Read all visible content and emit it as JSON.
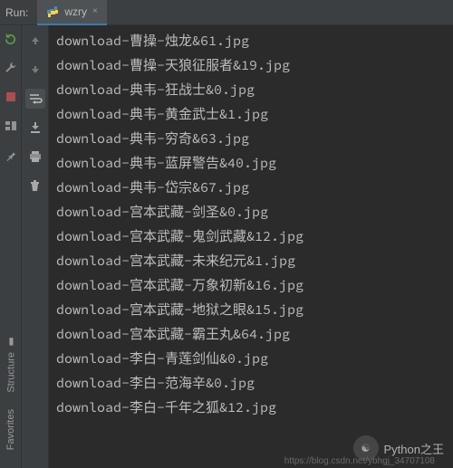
{
  "header": {
    "run_label": "Run:",
    "tab": {
      "label": "wzry",
      "close": "×"
    }
  },
  "console": {
    "lines": [
      "download-曹操-烛龙&61.jpg",
      "download-曹操-天狼征服者&19.jpg",
      "download-典韦-狂战士&0.jpg",
      "download-典韦-黄金武士&1.jpg",
      "download-典韦-穷奇&63.jpg",
      "download-典韦-蓝屏警告&40.jpg",
      "download-典韦-岱宗&67.jpg",
      "download-宫本武藏-剑圣&0.jpg",
      "download-宫本武藏-鬼剑武藏&12.jpg",
      "download-宫本武藏-未来纪元&1.jpg",
      "download-宫本武藏-万象初新&16.jpg",
      "download-宫本武藏-地狱之眼&15.jpg",
      "download-宫本武藏-霸王丸&64.jpg",
      "download-李白-青莲剑仙&0.jpg",
      "download-李白-范海辛&0.jpg",
      "download-李白-千年之狐&12.jpg"
    ]
  },
  "sidetabs": {
    "structure": "Structure",
    "favorites": "Favorites"
  },
  "watermark": {
    "text": "Python之王",
    "url": "https://blog.csdn.net/ybhgj_34707108"
  }
}
